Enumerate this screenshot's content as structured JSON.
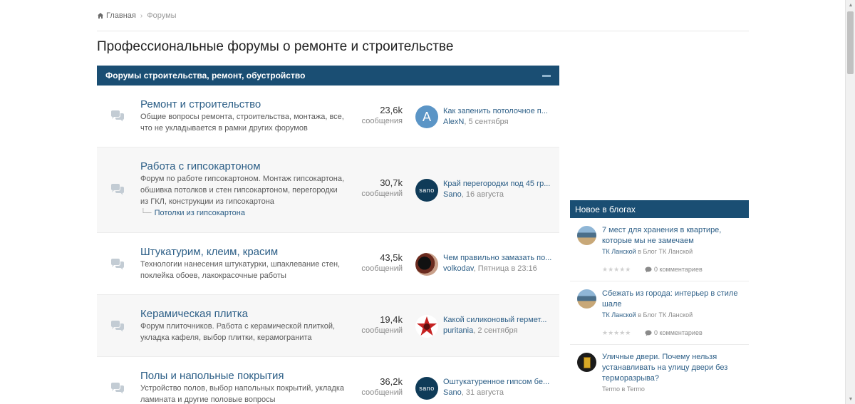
{
  "breadcrumb": {
    "home": "Главная",
    "current": "Форумы"
  },
  "page_title": "Профессиональные форумы о ремонте и строительстве",
  "forum_block": {
    "title": "Форумы строительства, ремонт, обустройство",
    "forums": [
      {
        "title": "Ремонт и строительство",
        "description": "Общие вопросы ремонта, строительства, монтажа, все, что не укладывается в рамки других форумов",
        "posts": "23,6k",
        "posts_label": "сообщения",
        "avatar_letter": "A",
        "last_title": "Как запенить потолочное п...",
        "last_author": "AlexN",
        "last_date": "5 сентября"
      },
      {
        "title": "Работа с гипсокартоном",
        "description": "Форум по работе гипсокартоном. Монтаж гипсокартона, обшивка потолков и стен гипсокартоном, перегородки из ГКЛ, конструкции из гипсокартона",
        "subforum": "Потолки из гипсокартона",
        "posts": "30,7k",
        "posts_label": "сообщений",
        "avatar_text": "sano",
        "last_title": "Край перегородки под 45 гр...",
        "last_author": "Sano",
        "last_date": "16 августа"
      },
      {
        "title": "Штукатурим, клеим, красим",
        "description": "Технологии нанесения штукатурки, шпаклевание стен, поклейка обоев, лакокрасочные работы",
        "posts": "43,5k",
        "posts_label": "сообщений",
        "last_title": "Чем правильно замазать по...",
        "last_author": "volkodav",
        "last_date": "Пятница в 23:16"
      },
      {
        "title": "Керамическая плитка",
        "description": "Форум плиточников. Работа с керамической плиткой, укладка кафеля, выбор плитки, керамогранита",
        "posts": "19,4k",
        "posts_label": "сообщений",
        "last_title": "Какой силиконовый гермет...",
        "last_author": "puritania",
        "last_date": "2 сентября"
      },
      {
        "title": "Полы и напольные покрытия",
        "description": "Устройство полов, выбор напольных покрытий, укладка ламината и другие половые вопросы",
        "posts": "36,2k",
        "posts_label": "сообщений",
        "avatar_text": "sano",
        "last_title": "Оштукатуренное гипсом бе...",
        "last_author": "Sano",
        "last_date": "31 августа"
      }
    ]
  },
  "blogs": {
    "title": "Новое в блогах",
    "items": [
      {
        "title": "7 мест для хранения в квартире, которые мы не замечаем",
        "author": "ТК Ланской",
        "in_label": "в",
        "blog": "Блог ТК Ланской",
        "stars": "★★★★★",
        "comments": "0 комментариев"
      },
      {
        "title": "Сбежать из города: интерьер в стиле шале",
        "author": "ТК Ланской",
        "in_label": "в",
        "blog": "Блог ТК Ланской",
        "stars": "★★★★★",
        "comments": "0 комментариев"
      },
      {
        "title": "Уличные двери. Почему нельзя устанавливать на улицу двери без терморазрыва?",
        "author": "Termo",
        "in_label": "в",
        "blog": "Termo"
      }
    ]
  },
  "colors": {
    "header_bg": "#1a4e73",
    "link": "#2d5f87"
  }
}
